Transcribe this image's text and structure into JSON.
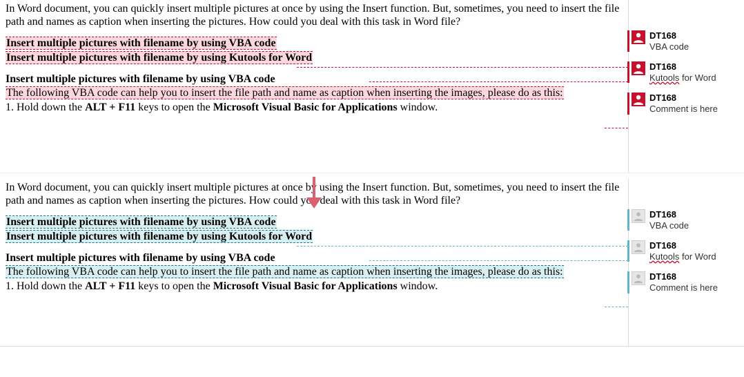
{
  "top": {
    "intro": "In Word document, you can quickly insert multiple pictures at once by using the Insert function. But, sometimes, you need to insert the file path and names as caption when inserting the pictures. How could you deal with this task in Word file?",
    "link1": "Insert multiple pictures with filename by using VBA code",
    "link2": "Insert multiple pictures with filename by using Kutools for Word",
    "heading": "Insert multiple pictures with filename by using VBA code",
    "desc": "The following VBA code can help you to insert the file path and name as caption when inserting the images, please do as this:",
    "step1_prefix": "1. Hold down the ",
    "step1_keys": "ALT + F11",
    "step1_mid": " keys to open the ",
    "step1_app": "Microsoft Visual Basic for Applications",
    "step1_suffix": " window."
  },
  "bot": {
    "intro": "In Word document, you can quickly insert multiple pictures at once by using the Insert function. But, sometimes, you need to insert the file path and names as caption when inserting the pictures. How could you deal with this task in Word file?",
    "link1": "Insert multiple pictures with filename by using VBA code",
    "link2": "Insert multiple pictures with filename by using Kutools for Word",
    "heading": "Insert multiple pictures with filename by using VBA code",
    "desc": "The following VBA code can help you to insert the file path and name as caption when inserting the images, please do as this:",
    "step1_prefix": "1. Hold down the ",
    "step1_keys": "ALT + F11",
    "step1_mid": " keys to open the ",
    "step1_app": "Microsoft Visual Basic for Applications",
    "step1_suffix": " window."
  },
  "comments": {
    "author": "DT168",
    "c1": "VBA code",
    "c2_pre": "Kutools",
    "c2_suf": " for Word",
    "c3": "Comment is here"
  },
  "colors": {
    "red_accent": "#c8102e",
    "blue_accent": "#5fb5c4",
    "pink_hl": "#fdd7e0",
    "blue_hl": "#d9eef0"
  }
}
